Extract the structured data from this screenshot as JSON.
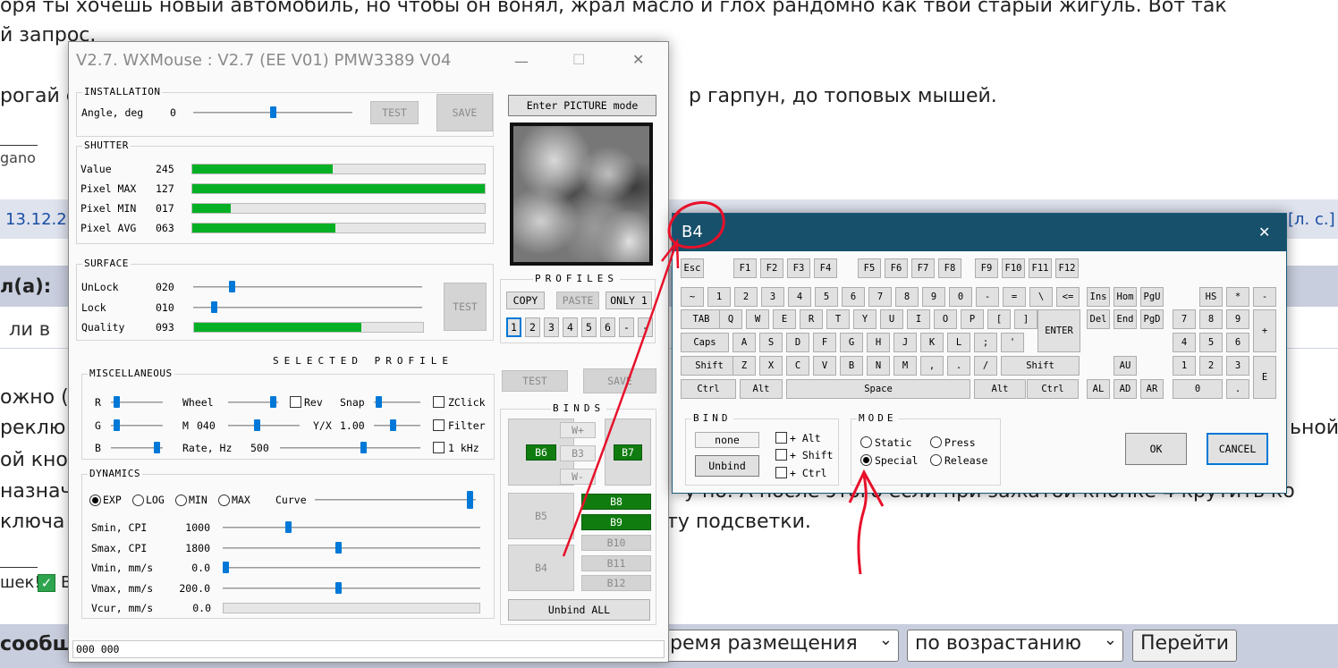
{
  "background": {
    "line1": "оря ты хочешь новый автомобиль, но чтобы он вонял, жрал масло и глох рандомно как твой старый жигуль. Вот так",
    "line2": "й запрос.",
    "line3a": "рогай с",
    "line3b": "р гарпун, до топовых мышей.",
    "sig": "gano",
    "date": "13.12.2",
    "links": "[л. с.]",
    "posted_by": "л(а):",
    "quote": "ли в",
    "p1": "ожно (",
    "p2": "реклю",
    "p3": "ой кно",
    "p4": "назнач",
    "p4b": "у по. А после этого если при зажатой кнопке 4 крутить ко",
    "p5": "ключа",
    "p5b": "ту подсветки.",
    "p2b": "ьной",
    "thanks": "шек!",
    "thanks_b": "В",
    "bottom_label": "сообщ",
    "sort_field": "ремя размещения",
    "sort_order": "по возрастанию",
    "go_button": "Перейти",
    "dropdown_chevron": "⌄"
  },
  "main_window": {
    "title": "V2.7. WXMouse : V2.7 (EE V01) PMW3389 V04",
    "controls": {
      "minimize": "—",
      "maximize": "☐",
      "close": "✕"
    },
    "installation": {
      "title": "INSTALLATION",
      "angle_label": "Angle, deg",
      "angle_value": "0",
      "angle_level": 0.5,
      "test_button": "TEST",
      "save_button": "SAVE"
    },
    "shutter": {
      "title": "SHUTTER",
      "rows": [
        {
          "label": "Value",
          "value": "245",
          "fill": 0.48
        },
        {
          "label": "Pixel MAX",
          "value": "127",
          "fill": 1.0
        },
        {
          "label": "Pixel MIN",
          "value": "017",
          "fill": 0.13
        },
        {
          "label": "Pixel AVG",
          "value": "063",
          "fill": 0.49
        }
      ]
    },
    "picture_button": "Enter PICTURE mode",
    "surface": {
      "title": "SURFACE",
      "unlock_label": "UnLock",
      "unlock_value": "020",
      "unlock_level": 0.16,
      "lock_label": "Lock",
      "lock_value": "010",
      "lock_level": 0.08,
      "quality_label": "Quality",
      "quality_value": "093",
      "quality_fill": 0.73,
      "test_button": "TEST"
    },
    "profiles": {
      "title": "PROFILES",
      "copy": "COPY",
      "paste": "PASTE",
      "only1": "ONLY 1",
      "slots": [
        "1",
        "2",
        "3",
        "4",
        "5",
        "6",
        "-",
        "-"
      ]
    },
    "selected_profile_title": "SELECTED PROFILE",
    "misc": {
      "title": "MISCELLANEOUS",
      "r": "R",
      "g": "G",
      "b": "B",
      "wheel": "Wheel",
      "rev": "Rev",
      "snap": "Snap",
      "zclick": "ZClick",
      "m_label": "M",
      "m_value": "040",
      "yx_label": "Y/X",
      "yx_value": "1.00",
      "filter": "Filter",
      "rate_label": "Rate, Hz",
      "rate_value": "500",
      "khz": "1 kHz",
      "r_level": 0.05,
      "g_level": 0.05,
      "b_level": 0.95,
      "wheel_level": 0.95,
      "snap_level": 0.05,
      "m_level": 0.4,
      "yx_level": 0.4,
      "rate_level": 0.6
    },
    "test_button2": "TEST",
    "save_button2": "SAVE",
    "binds": {
      "title": "BINDS",
      "w_plus": "W+",
      "b3": "B3",
      "w_minus": "W-",
      "b6": "B6",
      "b7": "B7",
      "b5": "B5",
      "b4": "B4",
      "b8": "B8",
      "b9": "B9",
      "b10": "B10",
      "b11": "B11",
      "b12": "B12",
      "unbind_all": "Unbind ALL"
    },
    "dynamics": {
      "title": "DYNAMICS",
      "modes": [
        "EXP",
        "LOG",
        "MIN",
        "MAX"
      ],
      "selected_mode": "EXP",
      "curve_label": "Curve",
      "curve_level": 0.98,
      "rows": [
        {
          "label": "Smin, CPI",
          "value": "1000",
          "level": 0.25
        },
        {
          "label": "Smax, CPI",
          "value": "1800",
          "level": 0.45
        },
        {
          "label": "Vmin, mm/s",
          "value": "0.0",
          "level": 0.0
        },
        {
          "label": "Vmax, mm/s",
          "value": "200.0",
          "level": 0.45
        }
      ],
      "vcur_label": "Vcur, mm/s",
      "vcur_value": "0.0"
    },
    "status_text": "000 000"
  },
  "bind_dialog": {
    "title": "B4",
    "close": "✕",
    "keys": {
      "esc": "Esc",
      "f_row": [
        "F1",
        "F2",
        "F3",
        "F4",
        "F5",
        "F6",
        "F7",
        "F8",
        "F9",
        "F10",
        "F11",
        "F12"
      ],
      "num_row": [
        "~",
        "1",
        "2",
        "3",
        "4",
        "5",
        "6",
        "7",
        "8",
        "9",
        "0",
        "-",
        "=",
        "\\",
        "<="
      ],
      "q_row": [
        "TAB",
        "Q",
        "W",
        "E",
        "R",
        "T",
        "Y",
        "U",
        "I",
        "O",
        "P",
        "[",
        "]"
      ],
      "enter": "ENTER",
      "a_row": [
        "Caps",
        "A",
        "S",
        "D",
        "F",
        "G",
        "H",
        "J",
        "K",
        "L",
        ";",
        "'"
      ],
      "z_row": [
        "Shift",
        "Z",
        "X",
        "C",
        "V",
        "B",
        "N",
        "M",
        ",",
        ".",
        "/",
        "Shift"
      ],
      "bottom_row": [
        "Ctrl",
        "Alt",
        "Space",
        "Alt",
        "Ctrl"
      ],
      "nav": [
        "Ins",
        "Hom",
        "PgU",
        "Del",
        "End",
        "PgD"
      ],
      "arrows": [
        "AU",
        "AL",
        "AD",
        "AR"
      ],
      "numpad": [
        "HS",
        "*",
        "-",
        "7",
        "8",
        "9",
        "+",
        "4",
        "5",
        "6",
        "1",
        "2",
        "3",
        "E",
        "0",
        "."
      ]
    },
    "bind": {
      "title": "BIND",
      "value": "none",
      "unbind": "Unbind",
      "alt": "+ Alt",
      "shift": "+ Shift",
      "ctrl": "+ Ctrl"
    },
    "mode": {
      "title": "MODE",
      "static": "Static",
      "press": "Press",
      "special": "Special",
      "release": "Release",
      "selected": "Special"
    },
    "ok": "OK",
    "cancel": "CANCEL"
  },
  "colors": {
    "accent_blue": "#0078d7",
    "meter_green": "#06b025",
    "bind_green": "#107c10",
    "dialog_title": "#17506b",
    "annotation_red": "#e8102a"
  }
}
